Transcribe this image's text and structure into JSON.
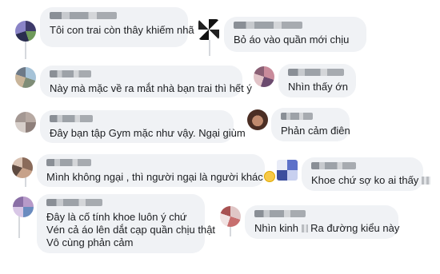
{
  "comments": [
    {
      "lines": [
        "Tôi con trai còn thây khiếm nhã"
      ]
    },
    {
      "lines": [
        "Bỏ áo vào quần mới chịu"
      ]
    },
    {
      "lines": [
        "Này mà mặc về ra mắt nhà bạn trai thì hết ý"
      ]
    },
    {
      "lines": [
        "Nhìn thấy ớn"
      ]
    },
    {
      "lines": [
        "Đây bạn tập Gym mặc như vậy. Ngại giùm"
      ]
    },
    {
      "lines": [
        "Phản cảm điên"
      ]
    },
    {
      "lines": [
        "Mình không ngại , thì người ngại là người khác"
      ],
      "emoji": "laughing-emoji"
    },
    {
      "lines": [
        "Khoe chứ sợ ko ai thấy"
      ]
    },
    {
      "lines": [
        "Đây là cố tính khoe luôn ý chứ",
        "Vén cả áo lên dắt cạp quần chịu thật",
        "Vô cùng phản cảm"
      ]
    },
    {
      "lines": [
        "Nhìn kinh",
        "Ra đường kiểu này"
      ]
    }
  ],
  "colors": {
    "bubble": "#f0f2f5",
    "text": "#1c1e21",
    "thread": "#d6d9dd"
  }
}
